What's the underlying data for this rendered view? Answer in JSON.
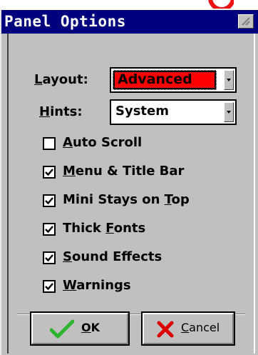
{
  "window": {
    "title": "Panel Options"
  },
  "layout": {
    "label_pre": "",
    "label_accel": "L",
    "label_post": "ayout:",
    "value": "Advanced"
  },
  "hints": {
    "label_pre": "",
    "label_accel": "H",
    "label_post": "ints:",
    "value": "System"
  },
  "options": [
    {
      "pre": "",
      "accel": "A",
      "post": "uto Scroll",
      "checked": false
    },
    {
      "pre": "",
      "accel": "M",
      "post": "enu & Title Bar",
      "checked": true
    },
    {
      "pre": "Mini Stays on ",
      "accel": "T",
      "post": "op",
      "checked": true
    },
    {
      "pre": "Thick ",
      "accel": "F",
      "post": "onts",
      "checked": true
    },
    {
      "pre": "",
      "accel": "S",
      "post": "ound Effects",
      "checked": true
    },
    {
      "pre": "",
      "accel": "W",
      "post": "arnings",
      "checked": true
    }
  ],
  "buttons": {
    "ok": {
      "pre": "",
      "accel": "O",
      "post": "K"
    },
    "cancel": {
      "pre": "",
      "accel": "C",
      "post": "ancel"
    }
  },
  "colors": {
    "titlebar": "#00007f",
    "dialog": "#c0c0c0",
    "highlight_bg": "#ff0000",
    "ok_check": "#2db52d",
    "cancel_x": "#dd0000"
  }
}
